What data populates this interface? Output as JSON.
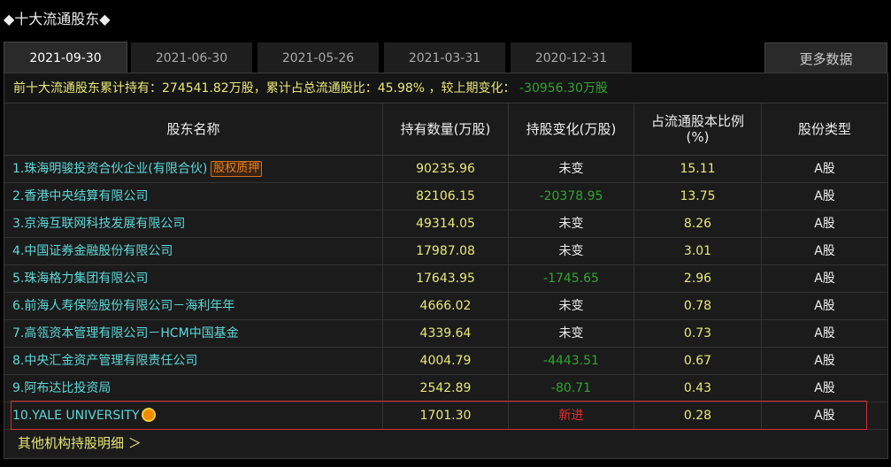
{
  "title": "◆十大流通股东◆",
  "tabs": [
    "2021-09-30",
    "2021-06-30",
    "2021-05-26",
    "2021-03-31",
    "2020-12-31"
  ],
  "more_label": "更多数据",
  "summary": {
    "prefix": "前十大流通股东累计持有：274541.82万股，累计占总流通股比：45.98% ，较上期变化：",
    "change": "-30956.30万股"
  },
  "headers": {
    "name": "股东名称",
    "qty": "持有数量(万股)",
    "change": "持股变化(万股)",
    "pct": "占流通股本比例",
    "pct_unit": "(%)",
    "type": "股份类型"
  },
  "rows": [
    {
      "name": "1.珠海明骏投资合伙企业(有限合伙)",
      "badge": "股权质押",
      "qty": "90235.96",
      "change": "未变",
      "ct": "w",
      "pct": "15.11",
      "type": "A股"
    },
    {
      "name": "2.香港中央结算有限公司",
      "qty": "82106.15",
      "change": "-20378.95",
      "ct": "g",
      "pct": "13.75",
      "type": "A股"
    },
    {
      "name": "3.京海互联网科技发展有限公司",
      "qty": "49314.05",
      "change": "未变",
      "ct": "w",
      "pct": "8.26",
      "type": "A股"
    },
    {
      "name": "4.中国证券金融股份有限公司",
      "qty": "17987.08",
      "change": "未变",
      "ct": "w",
      "pct": "3.01",
      "type": "A股"
    },
    {
      "name": "5.珠海格力集团有限公司",
      "qty": "17643.95",
      "change": "-1745.65",
      "ct": "g",
      "pct": "2.96",
      "type": "A股"
    },
    {
      "name": "6.前海人寿保险股份有限公司－海利年年",
      "qty": "4666.02",
      "change": "未变",
      "ct": "w",
      "pct": "0.78",
      "type": "A股"
    },
    {
      "name": "7.高瓴资本管理有限公司－HCM中国基金",
      "qty": "4339.64",
      "change": "未变",
      "ct": "w",
      "pct": "0.73",
      "type": "A股"
    },
    {
      "name": "8.中央汇金资产管理有限责任公司",
      "qty": "4004.79",
      "change": "-4443.51",
      "ct": "g",
      "pct": "0.67",
      "type": "A股"
    },
    {
      "name": "9.阿布达比投资局",
      "qty": "2542.89",
      "change": "-80.71",
      "ct": "g",
      "pct": "0.43",
      "type": "A股"
    },
    {
      "name": "10.YALE UNIVERSITY",
      "icon": "sun-icon",
      "qty": "1701.30",
      "change": "新进",
      "ct": "r",
      "pct": "0.28",
      "type": "A股"
    }
  ],
  "footer_link": "其他机构持股明细 ＞"
}
